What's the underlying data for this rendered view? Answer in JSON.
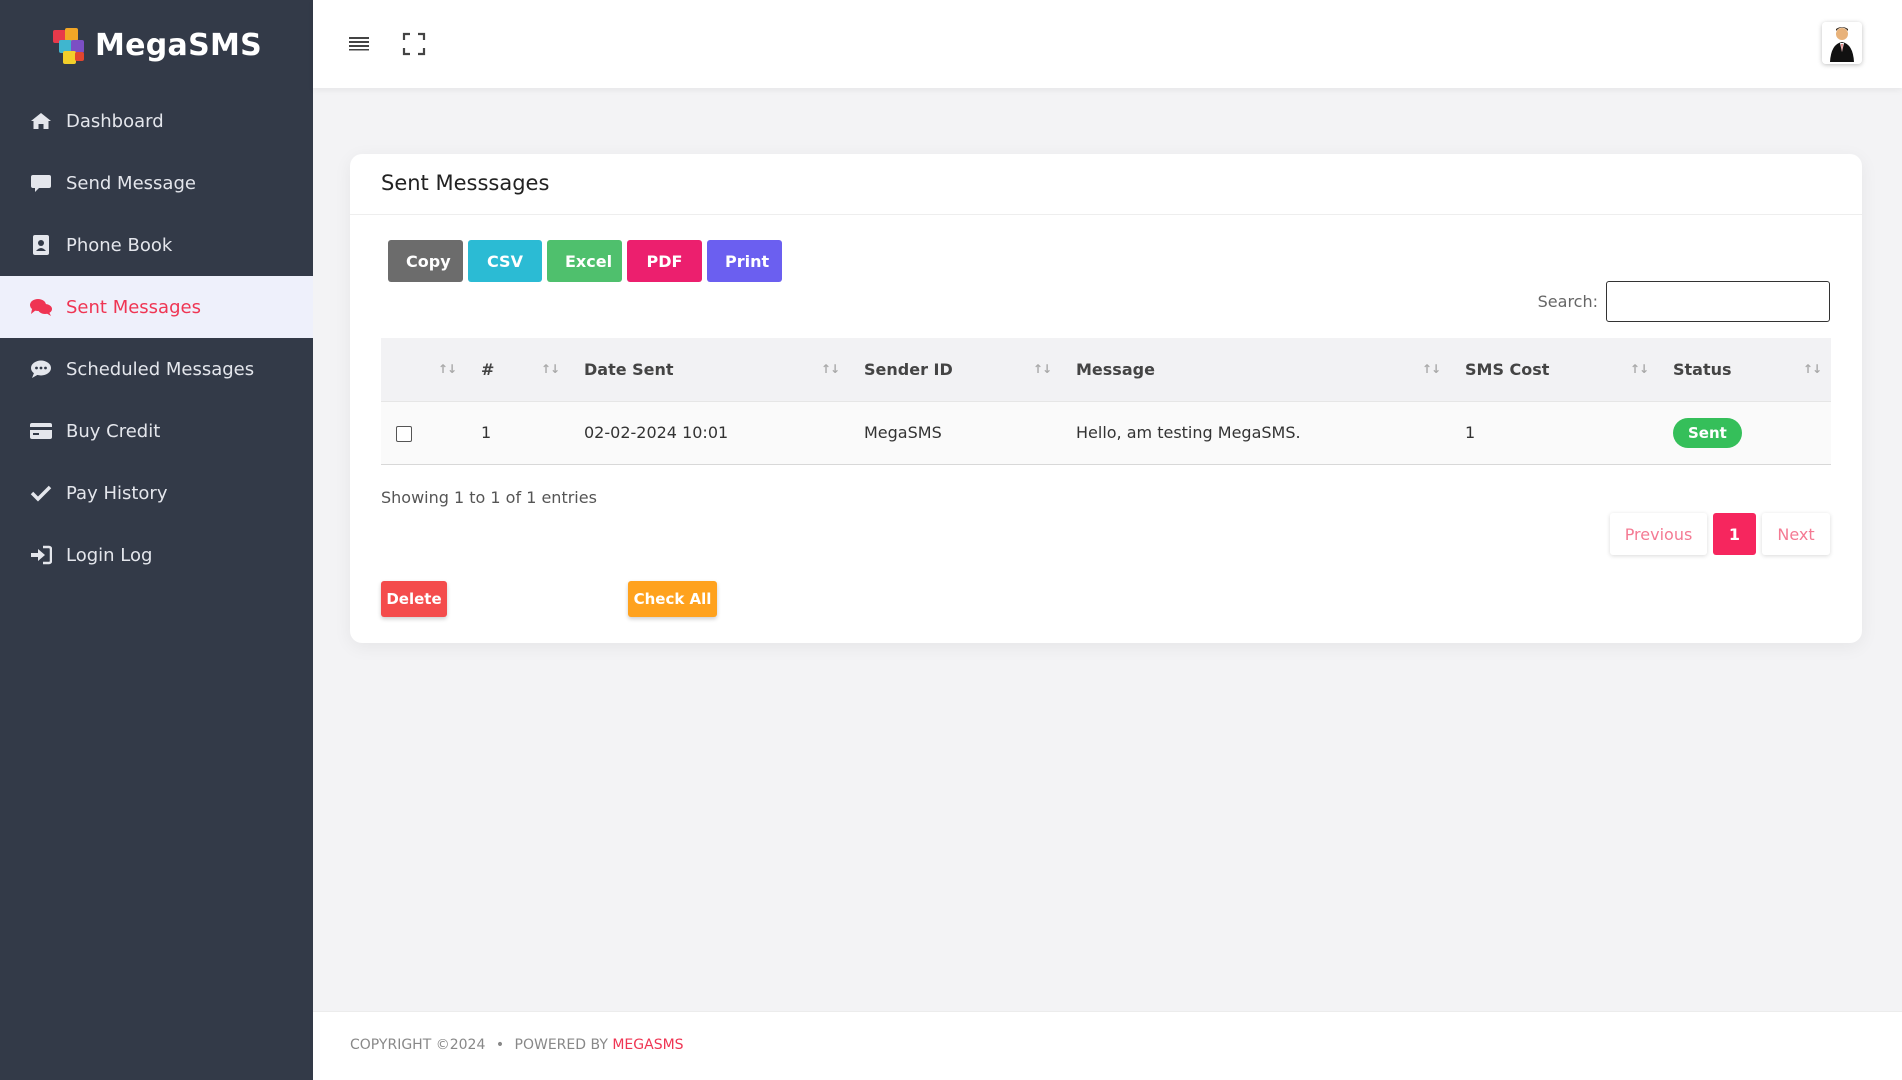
{
  "app": {
    "name": "MegaSMS"
  },
  "colors": {
    "accent": "#ef3553",
    "sidebar": "#333a48",
    "success": "#35bf5a"
  },
  "sidebar": {
    "items": [
      {
        "label": "Dashboard",
        "icon": "home-icon",
        "active": false
      },
      {
        "label": "Send Message",
        "icon": "chat-bubble-icon",
        "active": false
      },
      {
        "label": "Phone Book",
        "icon": "address-book-icon",
        "active": false
      },
      {
        "label": "Sent Messages",
        "icon": "comments-icon",
        "active": true
      },
      {
        "label": "Scheduled Messages",
        "icon": "comment-dots-icon",
        "active": false
      },
      {
        "label": "Buy Credit",
        "icon": "credit-card-icon",
        "active": false
      },
      {
        "label": "Pay History",
        "icon": "check-icon",
        "active": false
      },
      {
        "label": "Login Log",
        "icon": "sign-in-icon",
        "active": false
      }
    ]
  },
  "main": {
    "title": "Sent Messsages",
    "export_buttons": {
      "copy": "Copy",
      "csv": "CSV",
      "excel": "Excel",
      "pdf": "PDF",
      "print": "Print"
    },
    "search": {
      "label": "Search:",
      "value": ""
    },
    "table": {
      "columns": [
        "",
        "#",
        "Date Sent",
        "Sender ID",
        "Message",
        "SMS Cost",
        "Status"
      ],
      "rows": [
        {
          "num": "1",
          "date": "02-02-2024 10:01",
          "sender": "MegaSMS",
          "message": "Hello, am testing MegaSMS.",
          "cost": "1",
          "status": "Sent"
        }
      ]
    },
    "info": "Showing 1 to 1 of 1 entries",
    "pagination": {
      "previous": "Previous",
      "current": "1",
      "next": "Next"
    },
    "actions": {
      "delete": "Delete",
      "check_all": "Check All"
    }
  },
  "footer": {
    "copyright": "COPYRIGHT ©2024",
    "separator": "•",
    "powered": "POWERED BY",
    "brand": "MEGASMS"
  }
}
